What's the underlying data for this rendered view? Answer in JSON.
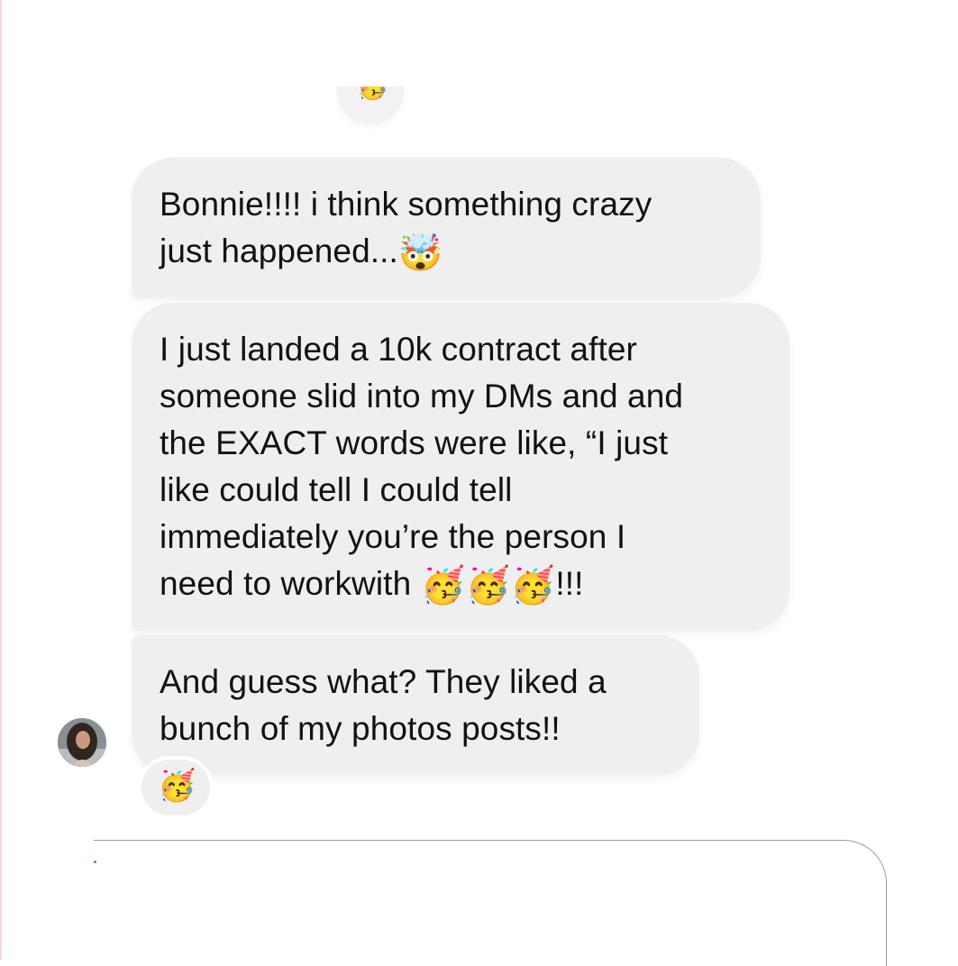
{
  "top_reaction": {
    "icon": "partying-face-emoji",
    "glyph": "🥳"
  },
  "messages": [
    {
      "lines": [
        "Bonnie!!!! i think something crazy",
        "just happened..."
      ],
      "trailing_emoji": {
        "icon": "exploding-head-emoji",
        "glyph": "🤯"
      }
    },
    {
      "lines": [
        "I just landed a 10k contract after",
        "someone slid into my DMs and and",
        "the EXACT words were like, “I just",
        "like could tell I could tell",
        "immediately you’re the person I",
        "need to workwith "
      ],
      "trailing_emoji": {
        "icon": "partying-face-emoji",
        "glyph": "🥳🥳🥳"
      },
      "trailing_text": "!!!"
    },
    {
      "lines": [
        "And guess what? They liked a",
        "bunch of my photos posts!!"
      ]
    }
  ],
  "message_reaction": {
    "icon": "partying-face-emoji",
    "glyph": "🥳"
  },
  "colors": {
    "bubble_background": "#efefef",
    "page_background": "#ffffff",
    "text": "#111111",
    "composer_border": "#9a9a9a"
  }
}
